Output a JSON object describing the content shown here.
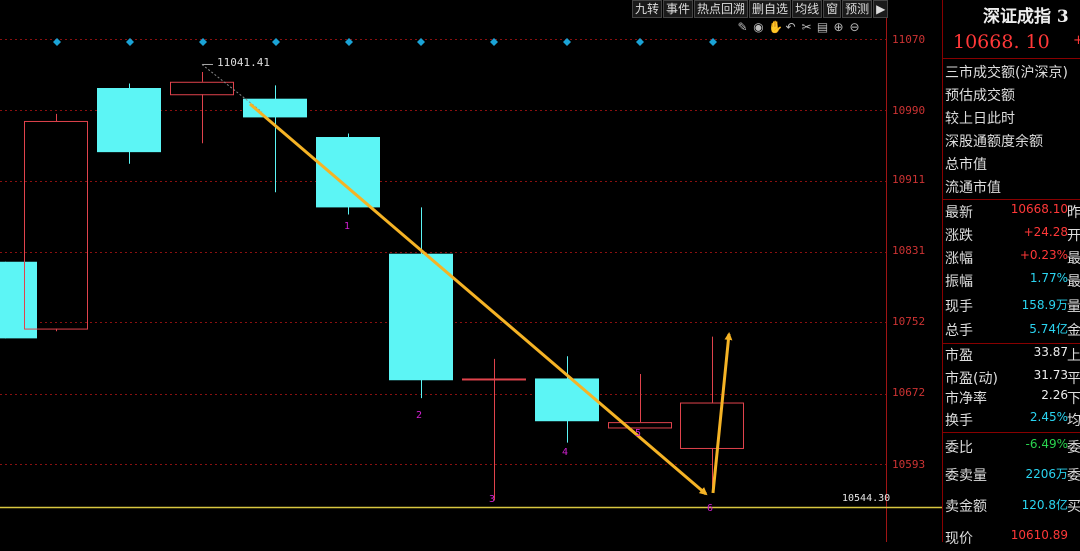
{
  "toolbar": {
    "buttons": [
      "九转",
      "事件",
      "热点回溯",
      "删自选",
      "均线",
      "窗",
      "预测"
    ],
    "arrow_label": "▶"
  },
  "tools": [
    "pen-icon",
    "eye-icon",
    "hand-icon",
    "undo-icon",
    "scissors-icon",
    "trash-icon",
    "zoom-in-icon",
    "zoom-out-icon"
  ],
  "axis": {
    "ticks": [
      "11070",
      "10990",
      "10911",
      "10831",
      "10752",
      "10672",
      "10593"
    ]
  },
  "chart_labels": {
    "high_label": "11041.41",
    "price_line_label": "10544.30",
    "waves": [
      "1",
      "2",
      "3",
      "4",
      "5",
      "6"
    ]
  },
  "chart_data": {
    "type": "candlestick",
    "y_ticks": [
      11070,
      10990,
      10911,
      10831,
      10752,
      10672,
      10593
    ],
    "ylim": [
      10515,
      11115
    ],
    "horizontal_line": 10544.3,
    "high_marker": 11041.41,
    "candles": [
      {
        "open": 10734,
        "close": 10820,
        "high": 10820,
        "low": 10734,
        "color": "cyan"
      },
      {
        "open": 10745,
        "close": 10978,
        "high": 10986,
        "low": 10742,
        "color": "red"
      },
      {
        "open": 10943,
        "close": 11015,
        "high": 11020,
        "low": 10930,
        "color": "cyan"
      },
      {
        "open": 11008,
        "close": 11022,
        "high": 11033,
        "low": 10953,
        "color": "red"
      },
      {
        "open": 10982,
        "close": 11003,
        "high": 11018,
        "low": 10898,
        "color": "cyan"
      },
      {
        "open": 10881,
        "close": 10960,
        "high": 10964,
        "low": 10873,
        "color": "cyan"
      },
      {
        "open": 10687,
        "close": 10829,
        "high": 10881,
        "low": 10667,
        "color": "cyan"
      },
      {
        "open": 10689,
        "close": 10689,
        "high": 10711,
        "low": 10552,
        "color": "red"
      },
      {
        "open": 10641,
        "close": 10689,
        "high": 10714,
        "low": 10617,
        "color": "cyan"
      },
      {
        "open": 10634,
        "close": 10640,
        "high": 10694,
        "low": 10633,
        "color": "red"
      },
      {
        "open": 10611,
        "close": 10662,
        "high": 10736,
        "low": 10566,
        "color": "red"
      }
    ]
  },
  "panel": {
    "title": "深证成指 3",
    "price": "10668. 10",
    "price_suffix": "+",
    "info": [
      "三市成交额(沪深京)",
      "预估成交额",
      "较上日此时",
      "深股通额度余额",
      "总市值",
      "流通市值"
    ],
    "rows": [
      {
        "k": "最新",
        "v": "10668.10",
        "vc": "red",
        "s": "昨"
      },
      {
        "k": "涨跌",
        "v": "+24.28",
        "vc": "red",
        "s": "开"
      },
      {
        "k": "涨幅",
        "v": "+0.23%",
        "vc": "red",
        "s": "最"
      },
      {
        "k": "振幅",
        "v": "1.77%",
        "vc": "cyan",
        "s": "最"
      },
      {
        "k": "现手",
        "v": "158.9万",
        "vc": "cyan",
        "s": "量"
      },
      {
        "k": "总手",
        "v": "5.74亿",
        "vc": "cyan",
        "s": "金"
      },
      {
        "k": "市盈",
        "v": "33.87",
        "vc": "white",
        "s": "上"
      },
      {
        "k": "市盈(动)",
        "v": "31.73",
        "vc": "white",
        "s": "平"
      },
      {
        "k": "市净率",
        "v": "2.26",
        "vc": "white",
        "s": "下"
      },
      {
        "k": "换手",
        "v": "2.45%",
        "vc": "cyan",
        "s": "均"
      },
      {
        "k": "委比",
        "v": "-6.49%",
        "vc": "green",
        "s": "委"
      },
      {
        "k": "委卖量",
        "v": "2206万",
        "vc": "cyan",
        "s": "委"
      },
      {
        "k": "卖金额",
        "v": "120.8亿",
        "vc": "cyan",
        "s": "买"
      },
      {
        "k": "现价",
        "v": "10610.89",
        "vc": "red",
        "s": ""
      }
    ]
  }
}
